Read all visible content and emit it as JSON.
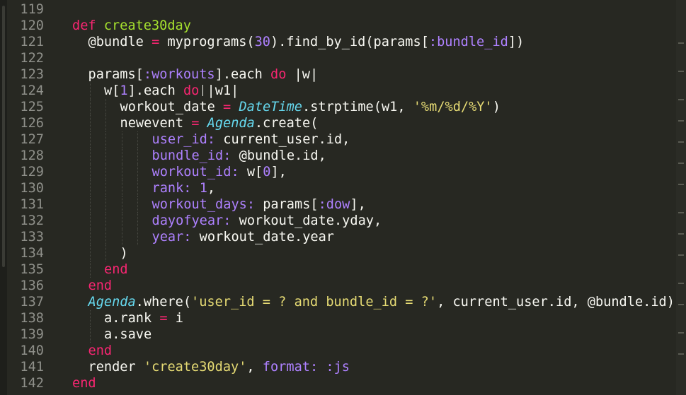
{
  "colors": {
    "background": "#272822",
    "line_number": "#8F908A",
    "keyword": "#F92672",
    "function_name": "#A6E22E",
    "constant": "#AE81FF",
    "class_name": "#66D9EF",
    "string": "#E6DB74",
    "plain": "#F8F8F2"
  },
  "lines": [
    {
      "num": "119",
      "indent": 0,
      "tokens": []
    },
    {
      "num": "120",
      "indent": 0,
      "tokens": [
        {
          "t": "def",
          "c": "keyword"
        },
        {
          "t": " ",
          "c": "plain"
        },
        {
          "t": "create30day",
          "c": "function_name"
        }
      ]
    },
    {
      "num": "121",
      "indent": 1,
      "tokens": [
        {
          "t": "@bundle ",
          "c": "plain"
        },
        {
          "t": "=",
          "c": "keyword"
        },
        {
          "t": " myprograms(",
          "c": "plain"
        },
        {
          "t": "30",
          "c": "constant"
        },
        {
          "t": ").find_by_id(params[",
          "c": "plain"
        },
        {
          "t": ":bundle_id",
          "c": "constant"
        },
        {
          "t": "])",
          "c": "plain"
        }
      ]
    },
    {
      "num": "122",
      "indent": 1,
      "tokens": []
    },
    {
      "num": "123",
      "indent": 1,
      "tokens": [
        {
          "t": "params[",
          "c": "plain"
        },
        {
          "t": ":workouts",
          "c": "constant"
        },
        {
          "t": "].each ",
          "c": "plain"
        },
        {
          "t": "do",
          "c": "keyword"
        },
        {
          "t": " |w|",
          "c": "plain"
        }
      ]
    },
    {
      "num": "124",
      "indent": 2,
      "tokens": [
        {
          "t": "w[",
          "c": "plain"
        },
        {
          "t": "1",
          "c": "constant"
        },
        {
          "t": "].each ",
          "c": "plain"
        },
        {
          "t": "do",
          "c": "keyword"
        },
        {
          "t": " |w1|",
          "c": "plain"
        }
      ]
    },
    {
      "num": "125",
      "indent": 3,
      "tokens": [
        {
          "t": "workout_date ",
          "c": "plain"
        },
        {
          "t": "=",
          "c": "keyword"
        },
        {
          "t": " ",
          "c": "plain"
        },
        {
          "t": "DateTime",
          "c": "class_name"
        },
        {
          "t": ".strptime(w1, ",
          "c": "plain"
        },
        {
          "t": "'%m/%d/%Y'",
          "c": "string"
        },
        {
          "t": ")",
          "c": "plain"
        }
      ]
    },
    {
      "num": "126",
      "indent": 3,
      "tokens": [
        {
          "t": "newevent ",
          "c": "plain"
        },
        {
          "t": "=",
          "c": "keyword"
        },
        {
          "t": " ",
          "c": "plain"
        },
        {
          "t": "Agenda",
          "c": "class_name"
        },
        {
          "t": ".create(",
          "c": "plain"
        }
      ]
    },
    {
      "num": "127",
      "indent": 5,
      "tokens": [
        {
          "t": "user_id:",
          "c": "constant"
        },
        {
          "t": " current_user.id,",
          "c": "plain"
        }
      ]
    },
    {
      "num": "128",
      "indent": 5,
      "tokens": [
        {
          "t": "bundle_id:",
          "c": "constant"
        },
        {
          "t": " @bundle.id,",
          "c": "plain"
        }
      ]
    },
    {
      "num": "129",
      "indent": 5,
      "tokens": [
        {
          "t": "workout_id:",
          "c": "constant"
        },
        {
          "t": " w[",
          "c": "plain"
        },
        {
          "t": "0",
          "c": "constant"
        },
        {
          "t": "],",
          "c": "plain"
        }
      ]
    },
    {
      "num": "130",
      "indent": 5,
      "tokens": [
        {
          "t": "rank:",
          "c": "constant"
        },
        {
          "t": " ",
          "c": "plain"
        },
        {
          "t": "1",
          "c": "constant"
        },
        {
          "t": ",",
          "c": "plain"
        }
      ]
    },
    {
      "num": "131",
      "indent": 5,
      "tokens": [
        {
          "t": "workout_days:",
          "c": "constant"
        },
        {
          "t": " params[",
          "c": "plain"
        },
        {
          "t": ":dow",
          "c": "constant"
        },
        {
          "t": "],",
          "c": "plain"
        }
      ]
    },
    {
      "num": "132",
      "indent": 5,
      "tokens": [
        {
          "t": "dayofyear:",
          "c": "constant"
        },
        {
          "t": " workout_date.yday,",
          "c": "plain"
        }
      ]
    },
    {
      "num": "133",
      "indent": 5,
      "tokens": [
        {
          "t": "year:",
          "c": "constant"
        },
        {
          "t": " workout_date.year",
          "c": "plain"
        }
      ]
    },
    {
      "num": "134",
      "indent": 3,
      "tokens": [
        {
          "t": ")",
          "c": "plain"
        }
      ]
    },
    {
      "num": "135",
      "indent": 2,
      "tokens": [
        {
          "t": "end",
          "c": "keyword"
        }
      ]
    },
    {
      "num": "136",
      "indent": 1,
      "tokens": [
        {
          "t": "end",
          "c": "keyword"
        }
      ]
    },
    {
      "num": "137",
      "indent": 1,
      "tokens": [
        {
          "t": "Agenda",
          "c": "class_name"
        },
        {
          "t": ".where(",
          "c": "plain"
        },
        {
          "t": "'user_id = ? and bundle_id = ?'",
          "c": "string"
        },
        {
          "t": ", current_user.id, @bundle.id)",
          "c": "plain"
        }
      ]
    },
    {
      "num": "138",
      "indent": 2,
      "tokens": [
        {
          "t": "a.rank ",
          "c": "plain"
        },
        {
          "t": "=",
          "c": "keyword"
        },
        {
          "t": " i",
          "c": "plain"
        }
      ]
    },
    {
      "num": "139",
      "indent": 2,
      "tokens": [
        {
          "t": "a.save",
          "c": "plain"
        }
      ]
    },
    {
      "num": "140",
      "indent": 1,
      "tokens": [
        {
          "t": "end",
          "c": "keyword"
        }
      ]
    },
    {
      "num": "141",
      "indent": 1,
      "tokens": [
        {
          "t": "render ",
          "c": "plain"
        },
        {
          "t": "'create30day'",
          "c": "string"
        },
        {
          "t": ", ",
          "c": "plain"
        },
        {
          "t": "format:",
          "c": "constant"
        },
        {
          "t": " ",
          "c": "plain"
        },
        {
          "t": ":js",
          "c": "constant"
        }
      ]
    },
    {
      "num": "142",
      "indent": 0,
      "tokens": [
        {
          "t": "end",
          "c": "keyword"
        }
      ]
    }
  ]
}
